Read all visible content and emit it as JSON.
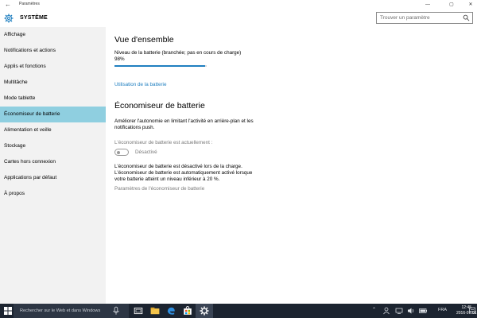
{
  "window": {
    "title": "Paramètres",
    "back_glyph": "←",
    "minimize_glyph": "—",
    "maximize_glyph": "▢",
    "close_glyph": "✕"
  },
  "header": {
    "section_title": "SYSTÈME",
    "search_placeholder": "Trouver un paramètre"
  },
  "sidebar": {
    "items": [
      {
        "label": "Affichage"
      },
      {
        "label": "Notifications et actions"
      },
      {
        "label": "Applis et fonctions"
      },
      {
        "label": "Multitâche"
      },
      {
        "label": "Mode tablette"
      },
      {
        "label": "Économiseur de batterie",
        "active": true
      },
      {
        "label": "Alimentation et veille"
      },
      {
        "label": "Stockage"
      },
      {
        "label": "Cartes hors connexion"
      },
      {
        "label": "Applications par défaut"
      },
      {
        "label": "À propos"
      }
    ]
  },
  "main": {
    "overview_title": "Vue d'ensemble",
    "battery_level_label": "Niveau de la batterie (branchée; pas en cours de charge)",
    "battery_percent": "98%",
    "battery_fraction": 0.98,
    "battery_usage_link": "Utilisation de la batterie",
    "saver_title": "Économiseur de batterie",
    "saver_desc_1": "Améliorer l'autonomie en limitant l'activité en arrière-plan et les",
    "saver_desc_2": "notifications push.",
    "status_label": "L'économiseur de batterie est actuellement :",
    "toggle_state": "Désactivé",
    "info_1": "L'économiseur de batterie est désactivé lors de la charge.",
    "info_2": "L'économiseur de batterie est automatiquement activé lorsque",
    "info_3": "votre batterie atteint un niveau inférieur à 20 %.",
    "settings_link": "Paramètres de l'économiseur de batterie"
  },
  "taskbar": {
    "search_text": "Rechercher sur le Web et dans Windows",
    "language": "FRA",
    "time": "12:45",
    "date": "2016-07-01"
  },
  "colors": {
    "accent": "#1f7fc0",
    "sidebar_active": "#8fcfe0",
    "taskbar": "#1c2430"
  }
}
